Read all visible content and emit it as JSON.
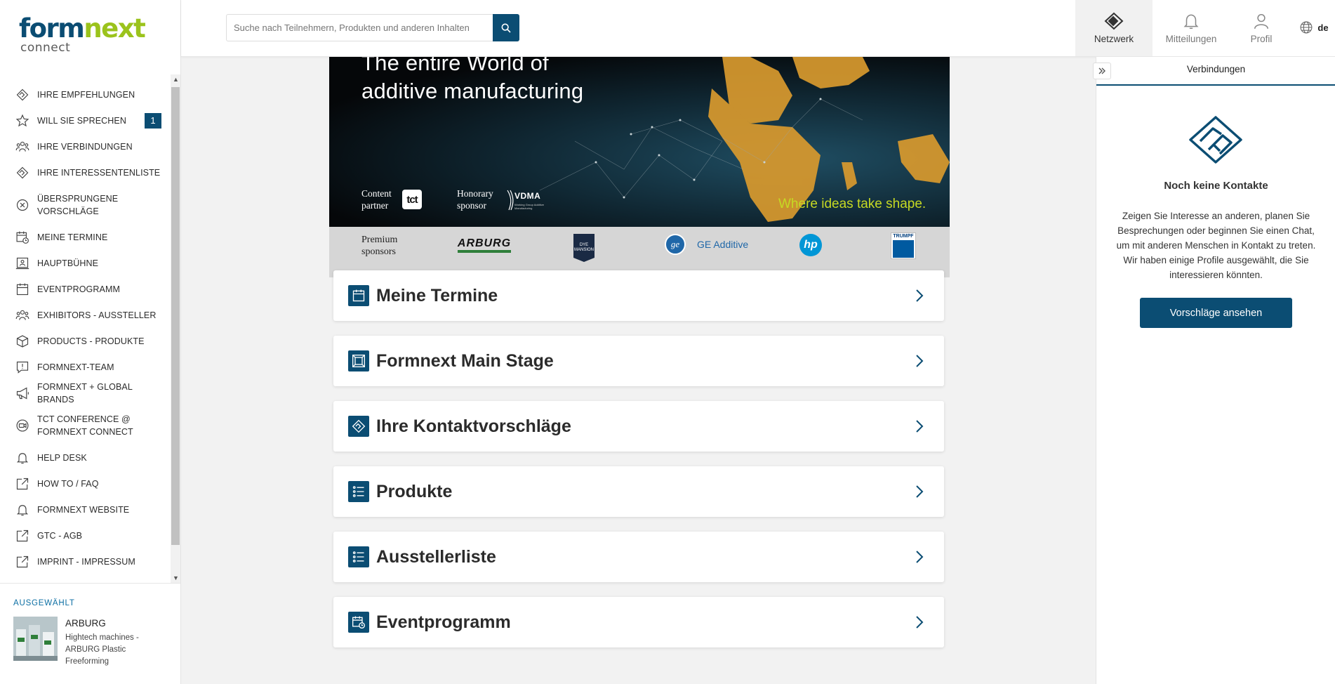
{
  "brand": {
    "line1_a": "form",
    "line1_b": "next",
    "line2": "connect"
  },
  "search": {
    "placeholder": "Suche nach Teilnehmern, Produkten und anderen Inhalten"
  },
  "header": {
    "tabs": [
      {
        "label": "Netzwerk",
        "icon": "handshake-icon",
        "active": true
      },
      {
        "label": "Mitteilungen",
        "icon": "bell-icon"
      },
      {
        "label": "Profil",
        "icon": "user-icon"
      }
    ],
    "language": "de"
  },
  "sidebar": {
    "items": [
      {
        "label": "Ihre Empfehlungen",
        "icon": "handshake-icon"
      },
      {
        "label": "Will Sie sprechen",
        "icon": "star-icon",
        "badge": "1"
      },
      {
        "label": "Ihre Verbindungen",
        "icon": "people-icon"
      },
      {
        "label": "Ihre Interessentenliste",
        "icon": "handshake-icon"
      },
      {
        "label": "Übersprungene Vorschläge",
        "icon": "x-circle-icon"
      },
      {
        "label": "Meine Termine",
        "icon": "calendar-clock-icon"
      },
      {
        "label": "Hauptbühne",
        "icon": "stage-icon"
      },
      {
        "label": "Eventprogramm",
        "icon": "calendar-icon"
      },
      {
        "label": "Exhibitors - Aussteller",
        "icon": "people-icon"
      },
      {
        "label": "Products - Produkte",
        "icon": "box-icon"
      },
      {
        "label": "Formnext-Team",
        "icon": "alert-message-icon"
      },
      {
        "label": "Formnext + Global Brands",
        "icon": "megaphone-icon"
      },
      {
        "label": "TCT Conference @ Formnext Connect",
        "icon": "video-icon"
      },
      {
        "label": "Help Desk",
        "icon": "bell-icon"
      },
      {
        "label": "How to / FAQ",
        "icon": "external-link-icon"
      },
      {
        "label": "Formnext Website",
        "icon": "bell-icon"
      },
      {
        "label": "GTC - AGB",
        "icon": "external-link-icon"
      },
      {
        "label": "Imprint - Impressum",
        "icon": "external-link-icon"
      }
    ],
    "selected": {
      "title": "AUSGEWÄHLT",
      "name": "ARBURG",
      "description": "Hightech machines - ARBURG Plastic Freeforming"
    }
  },
  "banner": {
    "headline_1": "The entire World of",
    "headline_2": "additive manufacturing",
    "content_partner": "Content partner",
    "content_partner_logo": "tct",
    "honorary_sponsor": "Honorary sponsor",
    "honorary_sponsor_logo": "VDMA",
    "honorary_sponsor_logo_sub": "Working Group Additive Manufacturing",
    "slogan": "Where ideas take shape.",
    "premium_sponsors": "Premium sponsors",
    "sponsors": [
      "ARBURG",
      "DYE MANSION",
      "GE Additive",
      "hp",
      "TRUMPF"
    ]
  },
  "cards": [
    {
      "label": "Meine Termine",
      "icon": "calendar-icon"
    },
    {
      "label": "Formnext Main Stage",
      "icon": "frame-icon"
    },
    {
      "label": "Ihre Kontaktvorschläge",
      "icon": "handshake-icon"
    },
    {
      "label": "Produkte",
      "icon": "list-icon"
    },
    {
      "label": "Ausstellerliste",
      "icon": "list-icon"
    },
    {
      "label": "Eventprogramm",
      "icon": "calendar-clock-icon"
    }
  ],
  "right_panel": {
    "tab": "Verbindungen",
    "empty_title": "Noch keine Kontakte",
    "empty_text": "Zeigen Sie Interesse an anderen, planen Sie Besprechungen oder beginnen Sie einen Chat, um mit anderen Menschen in Kontakt zu treten. Wir haben einige Profile ausgewählt, die Sie interessieren könnten.",
    "cta": "Vorschläge ansehen"
  },
  "colors": {
    "primary": "#0b4d73",
    "brand_green": "#9bc31c",
    "slogan": "#c6d923"
  }
}
